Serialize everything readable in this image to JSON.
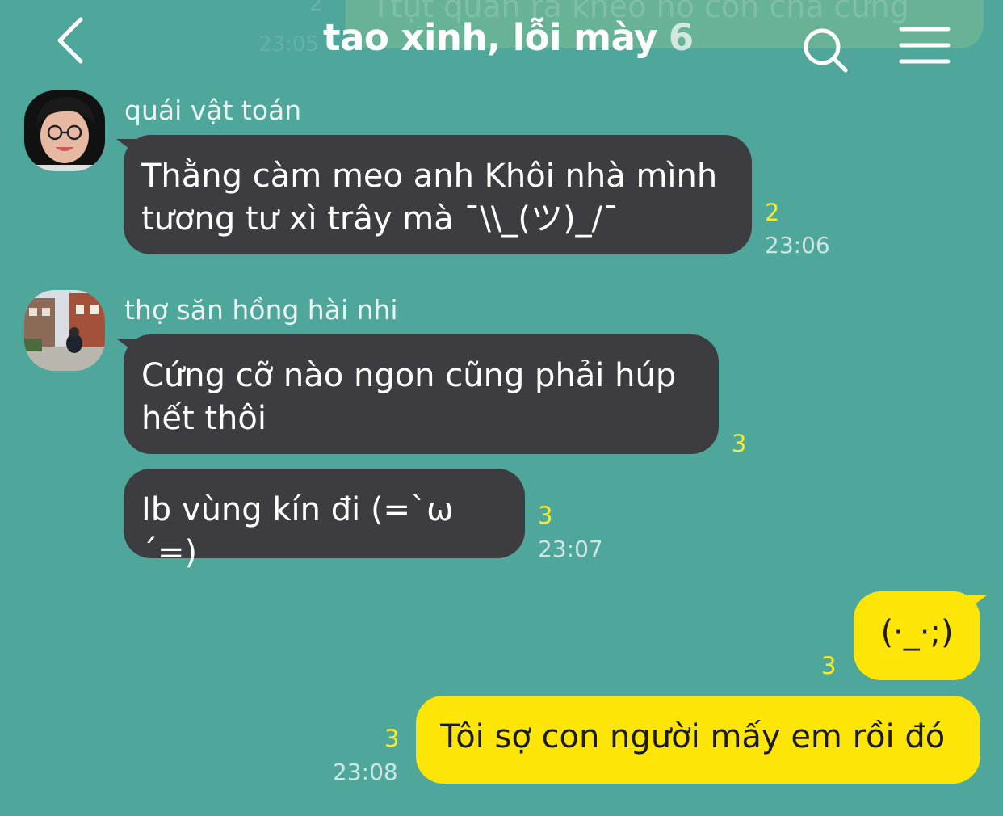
{
  "header": {
    "title": "tao xinh, lỗi mày",
    "member_count": "6",
    "ghost": {
      "text": "Ttụt quần ra khéo nó còn chả cứng",
      "number": "2",
      "time": "23:05"
    }
  },
  "messages": [
    {
      "sender": "quái vật toán",
      "lines": [
        "Thằng càm meo anh Khôi nhà mình",
        "tương tư xì trây mà ¯\\\\_(ツ)_/¯"
      ],
      "unread": "2",
      "time": "23:06"
    },
    {
      "sender": "thợ săn hồng hài nhi",
      "lines": [
        "Cứng cỡ nào ngon cũng phải húp",
        "hết thôi"
      ],
      "unread": "3"
    },
    {
      "lines": [
        "Ib vùng kín đi (=`ω´=)"
      ],
      "unread": "3",
      "time": "23:07"
    },
    {
      "lines": [
        "(·_·;)"
      ],
      "unread": "3"
    },
    {
      "lines": [
        "Tôi sợ con người mấy em rồi đó"
      ],
      "unread": "3",
      "time": "23:08"
    }
  ],
  "colors": {
    "background": "#4fa69b",
    "incoming_bubble": "#3c3c41",
    "outgoing_bubble": "#fde607",
    "unread": "#f8ec2a"
  },
  "icons": [
    "chevron-left-icon",
    "search-icon",
    "hamburger-menu-icon",
    "avatar-portrait",
    "avatar-street-photo"
  ]
}
